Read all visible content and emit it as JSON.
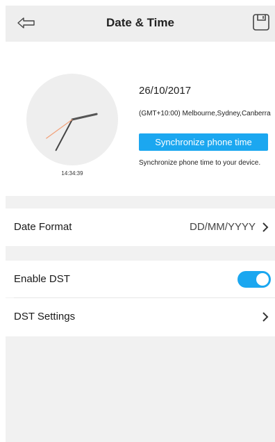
{
  "header": {
    "title": "Date & Time",
    "back_icon": "back-arrow-icon",
    "save_icon": "save-icon"
  },
  "clock": {
    "time": "14:34:39",
    "hour": 14,
    "minute": 34,
    "second": 39,
    "second_hand_color": "#f2a27a"
  },
  "info": {
    "date": "26/10/2017",
    "timezone": "(GMT+10:00) Melbourne,Sydney,Canberra",
    "sync_button_label": "Synchronize phone time",
    "sync_description": "Synchronize phone time to your device."
  },
  "settings": {
    "date_format_label": "Date Format",
    "date_format_value": "DD/MM/YYYY",
    "enable_dst_label": "Enable DST",
    "enable_dst_on": true,
    "dst_settings_label": "DST Settings"
  },
  "colors": {
    "accent": "#1ba7f0"
  }
}
